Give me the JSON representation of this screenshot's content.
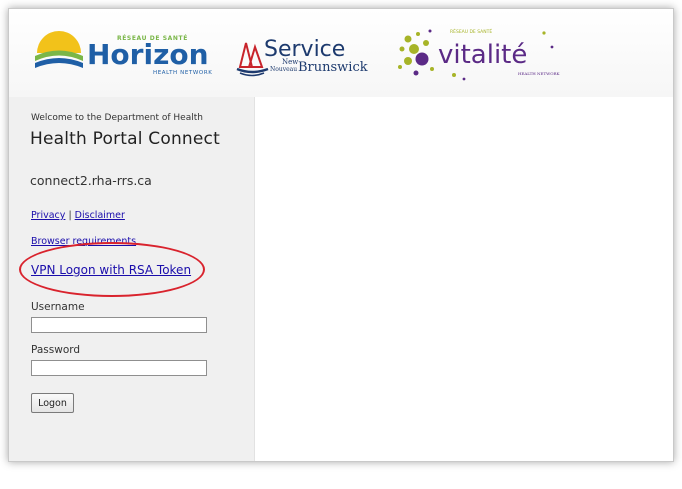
{
  "logos": {
    "horizon": {
      "top_text": "RÉSEAU DE SANTÉ",
      "name": "Horizon",
      "sub_text": "HEALTH NETWORK"
    },
    "service_nb": {
      "name": "Service",
      "new": "New",
      "nouveau": "Nouveau",
      "province": "Brunswick"
    },
    "vitalite": {
      "top_text": "RÉSEAU DE SANTÉ",
      "name": "vitalité",
      "sub_text": "HEALTH NETWORK"
    }
  },
  "sidebar": {
    "welcome": "Welcome to the Department of Health",
    "title": "Health Portal Connect",
    "server": "connect2.rha-rrs.ca",
    "privacy_link": "Privacy",
    "separator": "|",
    "disclaimer_link": "Disclaimer",
    "browser_link": "Browser requirements",
    "vpn_link": "VPN Logon with RSA Token"
  },
  "form": {
    "username_label": "Username",
    "username_value": "",
    "password_label": "Password",
    "password_value": "",
    "logon_button": "Logon"
  },
  "colors": {
    "horizon_blue": "#1f5fa6",
    "horizon_green": "#7ab648",
    "horizon_yellow": "#f2c21a",
    "sbn_navy": "#1d3a6e",
    "sbn_red": "#c8242b",
    "vitalite_purple": "#5b2a86",
    "vitalite_olive": "#a7b428",
    "highlight_red": "#d9232d",
    "link_blue": "#1a0dab"
  }
}
